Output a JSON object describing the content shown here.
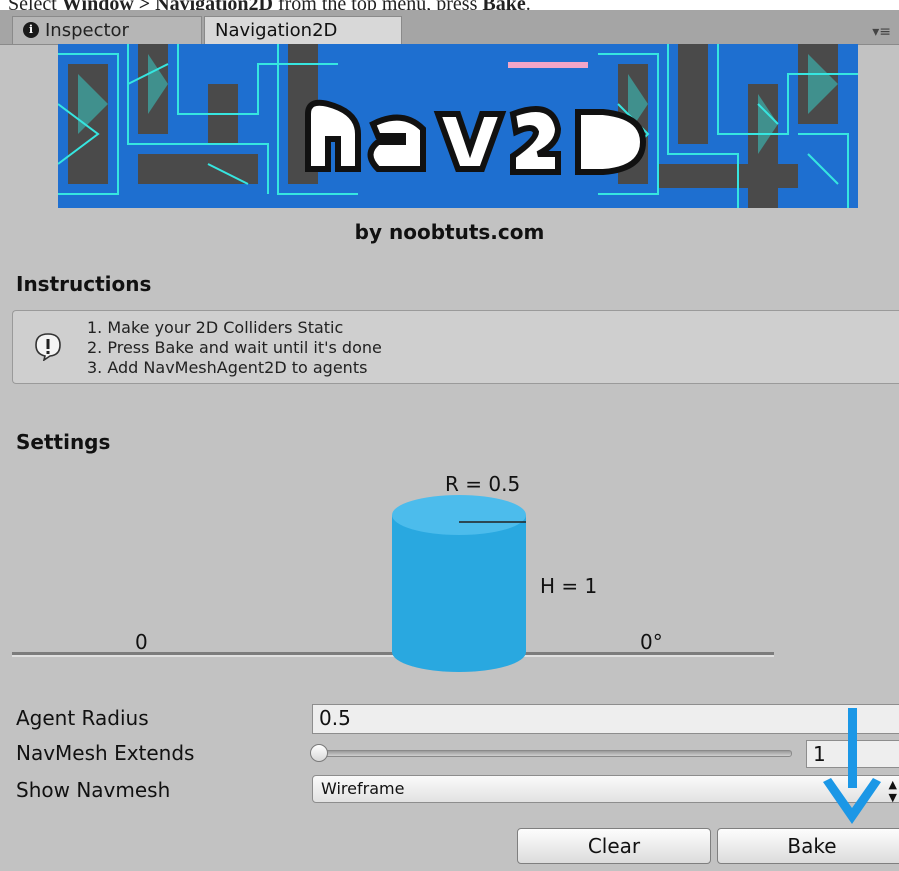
{
  "caption": {
    "prefix": "Select ",
    "menu_window": "Window",
    "sep": " > ",
    "menu_item": "Navigation2D",
    "middle": " from the top menu, press ",
    "action": "Bake",
    "suffix": "."
  },
  "tabs": [
    {
      "label": "Inspector",
      "icon": "info-icon"
    },
    {
      "label": "Navigation2D"
    }
  ],
  "banner": {
    "logo_text": "nav2D"
  },
  "byline": "by noobtuts.com",
  "instructions": {
    "title": "Instructions",
    "lines": [
      "1. Make your 2D Colliders Static",
      "2. Press Bake and wait until it's done",
      "3. Add NavMeshAgent2D to agents"
    ]
  },
  "settings": {
    "title": "Settings",
    "radius_label": "R = 0.5",
    "height_label": "H = 1",
    "left_label": "0",
    "right_label": "0°"
  },
  "fields": {
    "agent_radius_label": "Agent Radius",
    "agent_radius_value": "0.5",
    "navmesh_extends_label": "NavMesh Extends",
    "navmesh_extends_value": "1",
    "navmesh_extends_slider_fraction": 0.0,
    "show_navmesh_label": "Show Navmesh",
    "show_navmesh_value": "Wireframe"
  },
  "buttons": {
    "clear": "Clear",
    "bake": "Bake"
  },
  "colors": {
    "cylinder": "#29a8e0",
    "arrow": "#1b97e6",
    "banner_cyan": "#36e6e0",
    "banner_blue": "#1e6fd0"
  }
}
